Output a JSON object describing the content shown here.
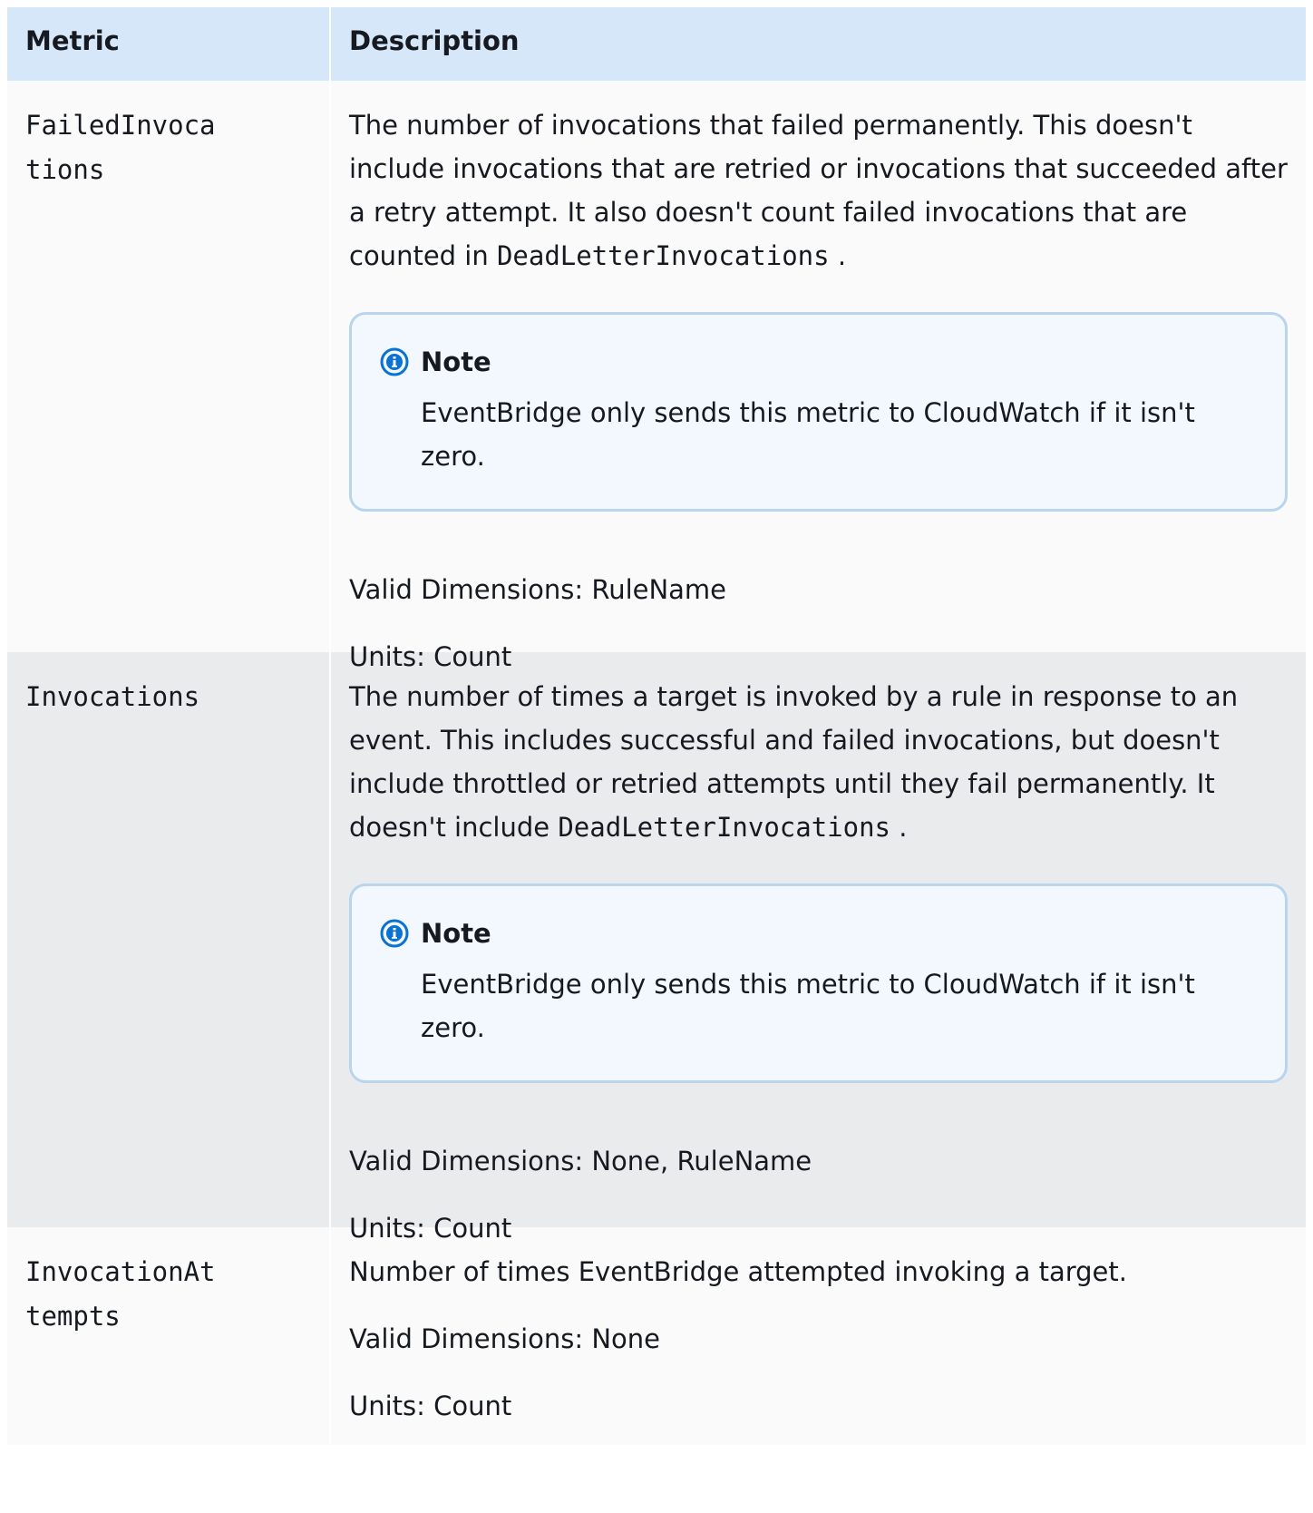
{
  "table": {
    "headers": {
      "metric": "Metric",
      "description": "Description"
    },
    "rows": [
      {
        "metric": "FailedInvocations",
        "description_before_code": "The number of invocations that failed permanently. This doesn't include invocations that are retried or invocations that succeeded after a retry attempt. It also doesn't count failed invocations that are counted in ",
        "description_code": "DeadLetterInvocations",
        "description_after_code": " .",
        "note_title": "Note",
        "note_text": "EventBridge only sends this metric to CloudWatch if it isn't zero.",
        "valid_dimensions": "Valid Dimensions: RuleName",
        "units": "Units: Count"
      },
      {
        "metric": "Invocations",
        "description_before_code": "The number of times a target is invoked by a rule in response to an event. This includes successful and failed invocations, but doesn't include throttled or retried attempts until they fail permanently. It doesn't include ",
        "description_code": "DeadLetterInvocations",
        "description_after_code": " .",
        "note_title": "Note",
        "note_text": "EventBridge only sends this metric to CloudWatch if it isn't zero.",
        "valid_dimensions": "Valid Dimensions: None, RuleName",
        "units": "Units: Count"
      },
      {
        "metric": "InvocationAttempts",
        "description": "Number of times EventBridge attempted invoking a target.",
        "valid_dimensions": "Valid Dimensions: None",
        "units": "Units: Count"
      }
    ]
  },
  "colors": {
    "header_bg": "#d5e7f8",
    "row_bg": "#fafafa",
    "row_alt_bg": "#eaebed",
    "note_bg": "#f2f8fd",
    "note_border": "#b8d4ef",
    "info_icon": "#0972d3"
  },
  "icons": {
    "note": "info-circle-icon"
  }
}
